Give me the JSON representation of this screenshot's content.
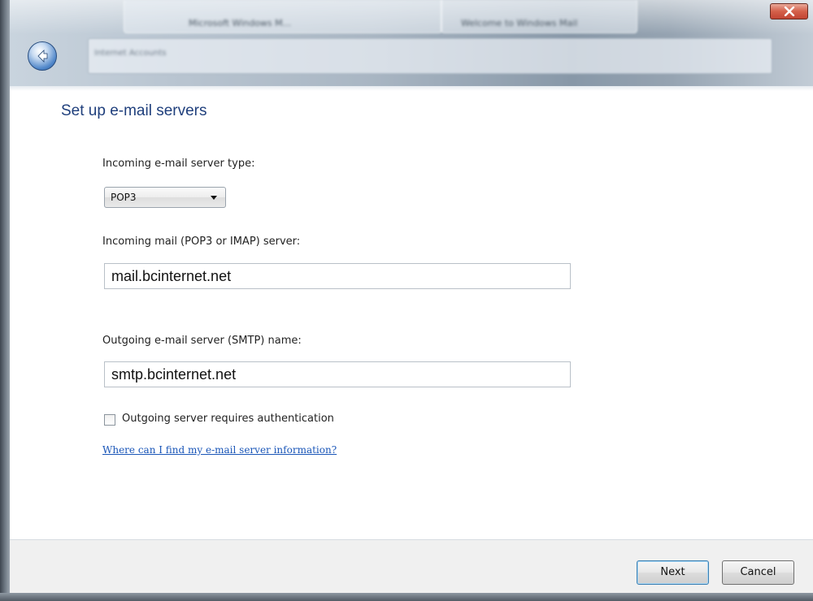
{
  "window": {
    "titlebar_tabs": [
      "Microsoft Windows M...",
      "Welcome to Windows Mail"
    ],
    "address_text": "Internet Accounts",
    "back_icon": "back-arrow-icon",
    "close_icon": "close-icon"
  },
  "page": {
    "title": "Set up e-mail servers"
  },
  "form": {
    "incoming_type_label": "Incoming e-mail server type:",
    "incoming_type_value": "POP3",
    "incoming_server_label": "Incoming mail (POP3 or IMAP) server:",
    "incoming_server_value": "mail.bcinternet.net",
    "outgoing_server_label": "Outgoing e-mail server (SMTP) name:",
    "outgoing_server_value": "smtp.bcinternet.net",
    "auth_checkbox_label": "Outgoing server requires authentication",
    "auth_checked": false,
    "help_link": "Where can I find my e-mail server information?"
  },
  "footer": {
    "next_label": "Next",
    "cancel_label": "Cancel"
  },
  "colors": {
    "title": "#1f3f7c",
    "link": "#1a56b8",
    "close_button": "#c24433"
  }
}
